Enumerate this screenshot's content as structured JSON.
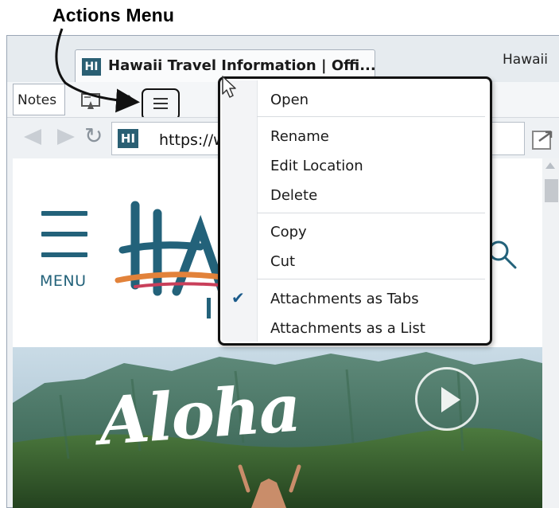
{
  "annotation": {
    "label": "Actions Menu"
  },
  "browser": {
    "active_tab_title": "Hawaii Travel Information | Offi...",
    "active_tab_favicon": "HI",
    "next_tab_title": "Hawaii",
    "notes_tab_label": "Notes",
    "url_favicon": "HI",
    "url_text": "https://w"
  },
  "toolbar": {
    "icons": [
      "attachment-icon",
      "pencil-icon",
      "hamburger-icon"
    ]
  },
  "page": {
    "menu_label": "MENU",
    "hero_text": "Aloha"
  },
  "context_menu": {
    "items": [
      {
        "label": "Open"
      },
      {
        "label": "Rename"
      },
      {
        "label": "Edit Location"
      },
      {
        "label": "Delete"
      },
      {
        "label": "Copy"
      },
      {
        "label": "Cut"
      },
      {
        "label": "Attachments as Tabs",
        "checked": true
      },
      {
        "label": "Attachments as a List",
        "checked": false
      }
    ],
    "check_glyph": "✔"
  },
  "colors": {
    "brand_teal": "#23627a",
    "menu_border": "#111111",
    "check": "#1a5a8a"
  }
}
